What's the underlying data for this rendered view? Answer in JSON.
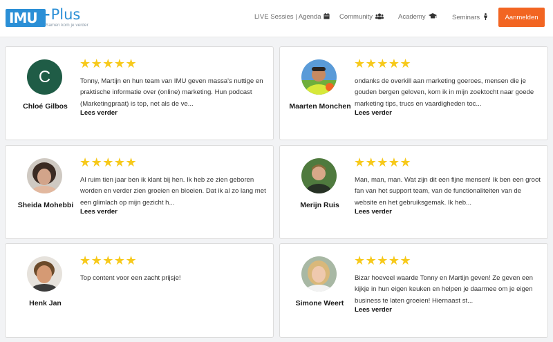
{
  "header": {
    "logo_main": "IMU",
    "logo_plus": "Plus",
    "logo_tagline": "Samen kom je verder",
    "nav_live": "LIVE Sessies | Agenda",
    "nav_community": "Community",
    "nav_academy": "Academy",
    "nav_seminars": "Seminars",
    "cta": "Aanmelden",
    "icons": [
      "calendar-icon",
      "users-icon",
      "graduation-cap-icon",
      "trophy-icon"
    ]
  },
  "reviews": [
    {
      "name": "Chloé Gilbos",
      "initial": "C",
      "stars": "★★★★★",
      "rating": 5,
      "text": "Tonny, Martijn en hun team van IMU geven massa's nuttige en praktische informatie over (online) marketing. Hun podcast (Marketingpraat) is top, net als de ve...",
      "more": "Lees verder"
    },
    {
      "name": "Maarten Monchen",
      "stars": "★★★★★",
      "rating": 5,
      "text": "ondanks de overkill aan marketing goeroes, mensen die je gouden bergen geloven, kom ik in mijn zoektocht naar goede marketing tips, trucs en vaardigheden toc...",
      "more": "Lees verder"
    },
    {
      "name": "Sheida Mohebbi",
      "stars": "★★★★★",
      "rating": 5,
      "text": "Al ruim tien jaar ben ik klant bij hen. Ik heb ze zien geboren worden en verder zien groeien en bloeien. Dat ik al zo lang met een glimlach op mijn gezicht h...",
      "more": "Lees verder"
    },
    {
      "name": "Merijn Ruis",
      "stars": "★★★★★",
      "rating": 5,
      "text": "Man, man, man. Wat zijn dit een fijne mensen! Ik ben een groot fan van het support team, van de functionaliteiten van de website en het gebruiksgemak. Ik heb...",
      "more": "Lees verder"
    },
    {
      "name": "Henk Jan",
      "stars": "★★★★★",
      "rating": 5,
      "text": "Top content voor een zacht prijsje!",
      "more": ""
    },
    {
      "name": "Simone Weert",
      "stars": "★★★★★",
      "rating": 5,
      "text": "Bizar hoeveel waarde Tonny en Martijn geven! Ze geven een kijkje in hun eigen keuken en helpen je daarmee om je eigen business te laten groeien! Hiernaast st...",
      "more": "Lees verder"
    }
  ],
  "colors": {
    "accent": "#f26522",
    "brand": "#2b8fd6",
    "star": "#f7c91a"
  }
}
